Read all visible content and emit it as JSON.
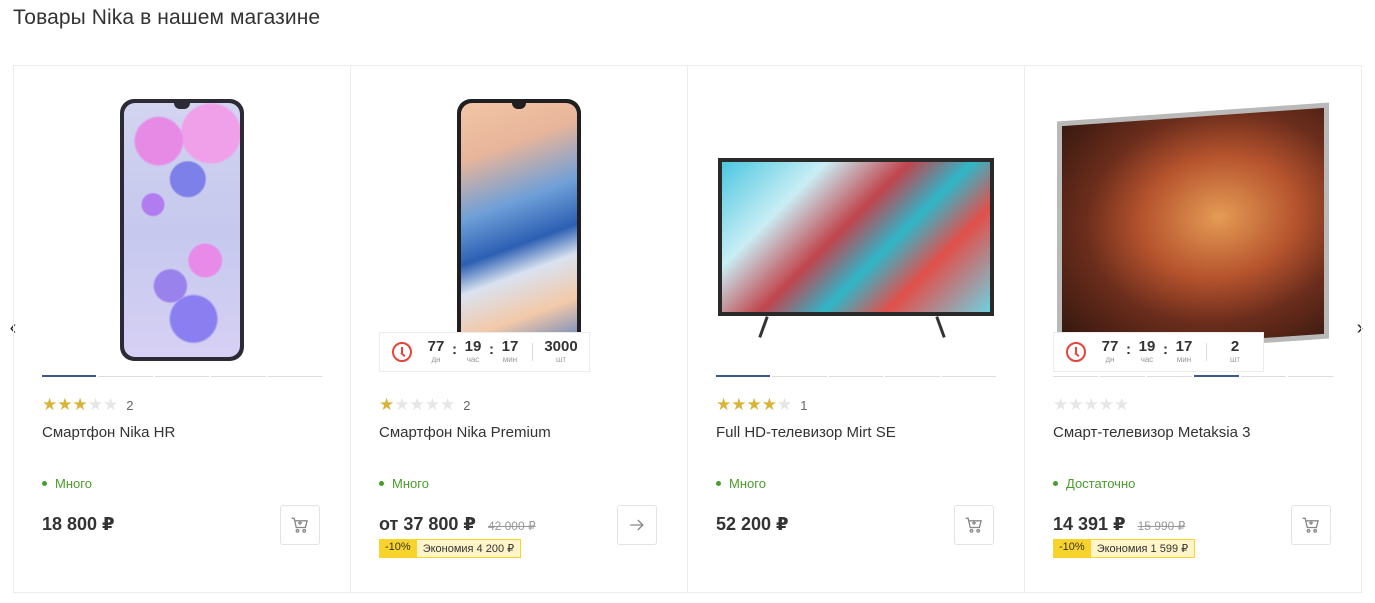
{
  "section": {
    "title": "Товары Nika в нашем магазине"
  },
  "nav": {
    "prev_icon": "chevron-left-icon",
    "next_icon": "chevron-right-icon"
  },
  "products": [
    {
      "name": "Смартфон Nika HR",
      "rating": 3,
      "reviews": "2",
      "stock": "Много",
      "price": "18 800 ₽",
      "old_price": "",
      "discount_pct": "",
      "discount_save": "",
      "action_icon": "cart-icon",
      "image_slides": 5,
      "active_slide": 1,
      "timer": null
    },
    {
      "name": "Смартфон Nika Premium",
      "rating": 1,
      "reviews": "2",
      "stock": "Много",
      "price": "от 37 800 ₽",
      "old_price": "42 000 ₽",
      "discount_pct": "-10%",
      "discount_save": "Экономия 4 200 ₽",
      "action_icon": "arrow-right-icon",
      "image_slides": 0,
      "active_slide": 0,
      "timer": {
        "days": "77",
        "days_label": "дн",
        "hours": "19",
        "hours_label": "час",
        "minutes": "17",
        "minutes_label": "мин",
        "qty": "3000",
        "qty_label": "шт"
      }
    },
    {
      "name": "Full HD-телевизор Mirt SE",
      "rating": 4,
      "reviews": "1",
      "stock": "Много",
      "price": "52 200 ₽",
      "old_price": "",
      "discount_pct": "",
      "discount_save": "",
      "action_icon": "cart-icon",
      "image_slides": 5,
      "active_slide": 1,
      "timer": null
    },
    {
      "name": "Смарт-телевизор Metaksia 3",
      "rating": 0,
      "reviews": "",
      "stock": "Достаточно",
      "price": "14 391 ₽",
      "old_price": "15 990 ₽",
      "discount_pct": "-10%",
      "discount_save": "Экономия 1 599 ₽",
      "action_icon": "cart-icon",
      "image_slides": 6,
      "active_slide": 4,
      "timer": {
        "days": "77",
        "days_label": "дн",
        "hours": "19",
        "hours_label": "час",
        "minutes": "17",
        "minutes_label": "мин",
        "qty": "2",
        "qty_label": "шт"
      }
    }
  ],
  "colors": {
    "star_on": "#d9b43b",
    "stock_green": "#4a9c2c",
    "timer_red": "#e5433b",
    "discount_yellow": "#f7d32c",
    "slide_active": "#3a5a8c"
  }
}
